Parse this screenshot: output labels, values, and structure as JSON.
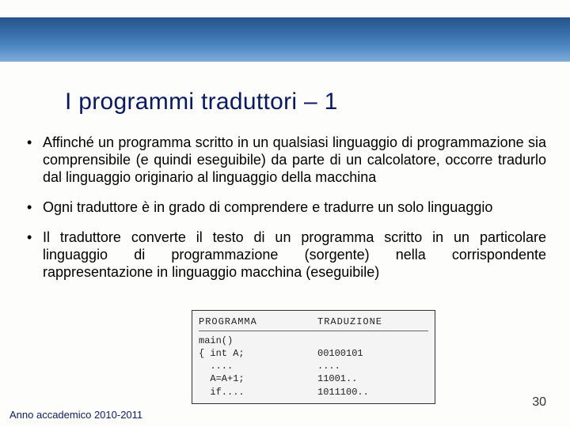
{
  "title": "I programmi traduttori – 1",
  "bullets": [
    "Affinché un programma scritto in un qualsiasi linguaggio di programmazione sia comprensibile (e quindi eseguibile) da parte di un calcolatore, occorre tradurlo dal linguaggio originario al linguaggio della macchina",
    "Ogni traduttore è in grado di comprendere e tradurre un solo linguaggio",
    "Il traduttore converte il testo di un programma scritto in un particolare linguaggio di programmazione (sorgente) nella corrispondente rappresentazione in linguaggio macchina (eseguibile)"
  ],
  "table": {
    "headers": {
      "prog": "PROGRAMMA",
      "trad": "TRADUZIONE"
    },
    "rows": [
      {
        "prog": "main()",
        "trad": ""
      },
      {
        "prog": "{ int A;",
        "trad": "00100101"
      },
      {
        "prog": "  ....",
        "trad": "...."
      },
      {
        "prog": "  A=A+1;",
        "trad": "11001.."
      },
      {
        "prog": "  if....",
        "trad": "1011100.."
      }
    ]
  },
  "footer": "Anno accademico 2010-2011",
  "page": "30"
}
